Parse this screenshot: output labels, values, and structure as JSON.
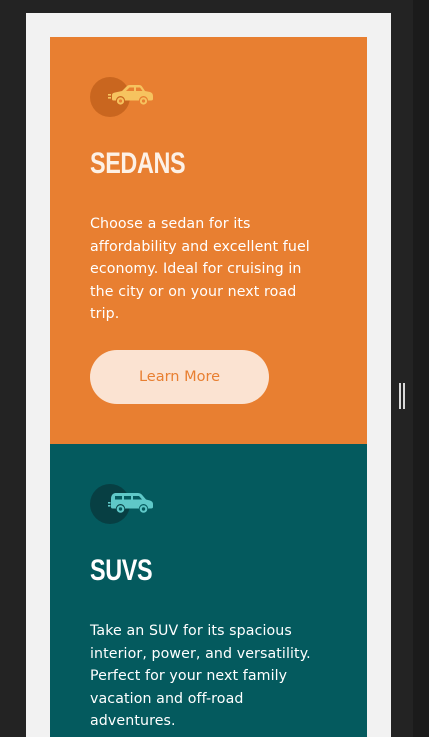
{
  "colors": {
    "background": "#232323",
    "frame": "#f2f2f2",
    "sedans_card": "#e87f31",
    "sedans_icon": "#f6c35f",
    "suvs_card": "#045a5e",
    "suvs_icon": "#5fc8c8",
    "button_bg": "#fbe3d2",
    "button_text": "#e87f31"
  },
  "cards": [
    {
      "icon": "sedan-car-icon",
      "title": "Sedans",
      "description": "Choose a sedan for its affordability and excellent fuel economy. Ideal for cruising in the city or on your next road trip.",
      "button_label": "Learn More"
    },
    {
      "icon": "suv-car-icon",
      "title": "SUVs",
      "description": "Take an SUV for its spacious interior, power, and versatility. Perfect for your next family vacation and off-road adventures."
    }
  ]
}
